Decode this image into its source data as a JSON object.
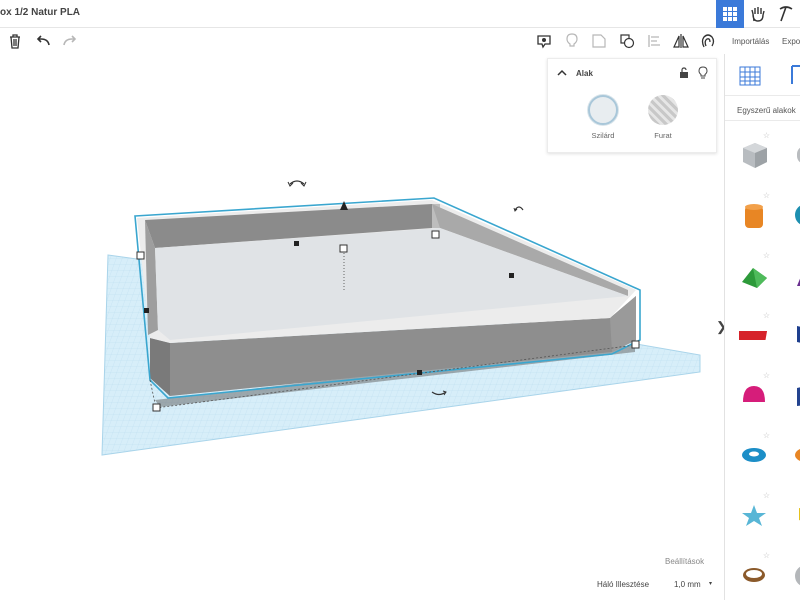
{
  "header": {
    "title": "ox 1/2 Natur PLA"
  },
  "side_top": {
    "import_label": "Importálás",
    "export_label": "Expo"
  },
  "shape_panel": {
    "title": "Alak",
    "solid_label": "Szilárd",
    "hole_label": "Furat"
  },
  "library": {
    "category": "Egyszerű alakok"
  },
  "footer": {
    "settings_label": "Beállítások",
    "snap_label": "Háló Illesztése",
    "snap_value": "1,0 mm"
  },
  "colors": {
    "accent": "#3b7ad9",
    "selection": "#3aa6cf",
    "workplane": "#cde9f6",
    "box_wall": "#8d8d8d"
  }
}
